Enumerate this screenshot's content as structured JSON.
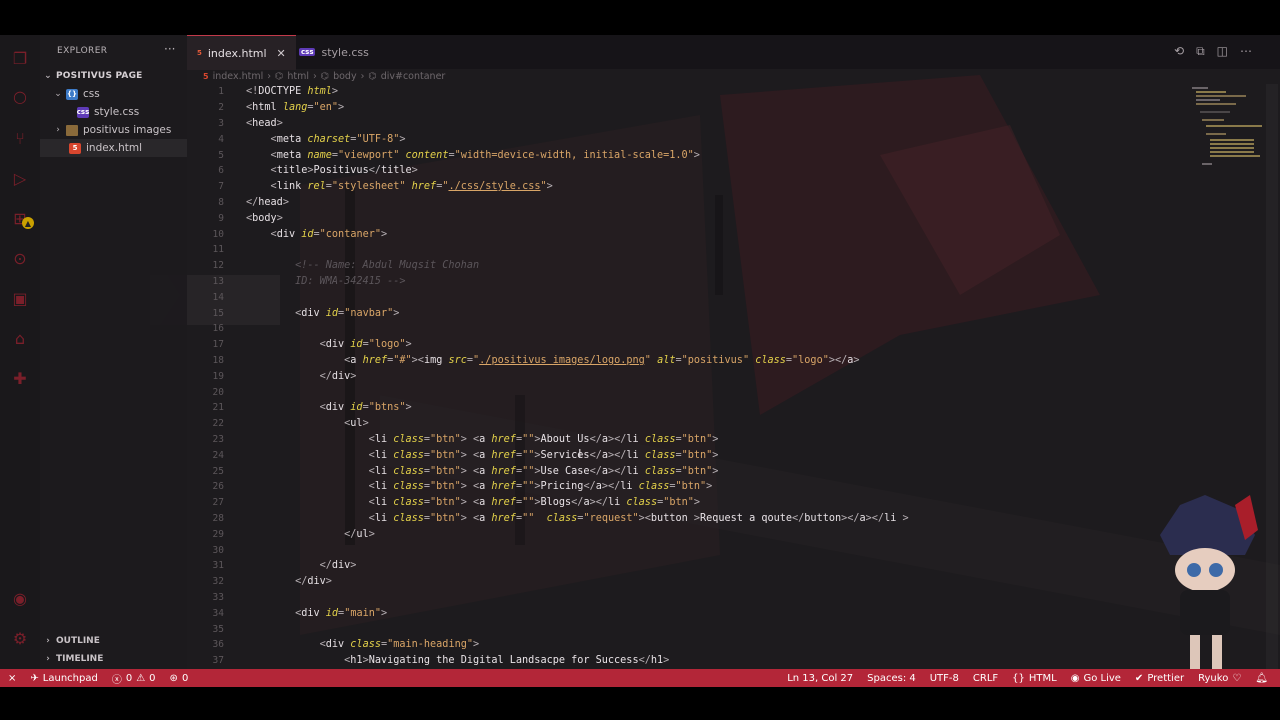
{
  "sidebar": {
    "title": "EXPLORER",
    "more": "···",
    "project": "POSITIVUS PAGE",
    "items": [
      {
        "label": "css",
        "type": "folder-open",
        "indent": 1
      },
      {
        "label": "style.css",
        "type": "css",
        "indent": 2
      },
      {
        "label": "positivus images",
        "type": "folder",
        "indent": 1
      },
      {
        "label": "index.html",
        "type": "html",
        "indent": 1
      }
    ],
    "outline": "OUTLINE",
    "timeline": "TIMELINE"
  },
  "tabs": [
    {
      "label": "index.html",
      "icon": "html-file-icon",
      "active": true
    },
    {
      "label": "style.css",
      "icon": "css-file-icon",
      "active": false
    }
  ],
  "breadcrumb": [
    "index.html",
    "html",
    "body",
    "div#contaner"
  ],
  "code": {
    "line_numbers": [
      "1",
      "2",
      "3",
      "4",
      "5",
      "6",
      "7",
      "8",
      "9",
      "10",
      "11",
      "12",
      "13",
      "14",
      "15",
      "16",
      "17",
      "18",
      "19",
      "20",
      "21",
      "22",
      "23",
      "24",
      "25",
      "26",
      "27",
      "28",
      "29",
      "30",
      "31",
      "32",
      "33",
      "34",
      "35",
      "36",
      "37"
    ],
    "lines": [
      [
        [
          "br",
          "<!"
        ],
        [
          "tag",
          "DOCTYPE "
        ],
        [
          "attr",
          "html"
        ],
        [
          "br",
          ">"
        ]
      ],
      [
        [
          "br",
          "<"
        ],
        [
          "tag",
          "html "
        ],
        [
          "attr",
          "lang"
        ],
        [
          "br",
          "="
        ],
        [
          "str",
          "\"en\""
        ],
        [
          "br",
          ">"
        ]
      ],
      [
        [
          "br",
          "<"
        ],
        [
          "tag",
          "head"
        ],
        [
          "br",
          ">"
        ]
      ],
      [
        [
          "txt",
          "    "
        ],
        [
          "br",
          "<"
        ],
        [
          "tag",
          "meta "
        ],
        [
          "attr",
          "charset"
        ],
        [
          "br",
          "="
        ],
        [
          "str",
          "\"UTF-8\""
        ],
        [
          "br",
          ">"
        ]
      ],
      [
        [
          "txt",
          "    "
        ],
        [
          "br",
          "<"
        ],
        [
          "tag",
          "meta "
        ],
        [
          "attr",
          "name"
        ],
        [
          "br",
          "="
        ],
        [
          "str",
          "\"viewport\" "
        ],
        [
          "attr",
          "content"
        ],
        [
          "br",
          "="
        ],
        [
          "str",
          "\"width=device-width, initial-scale=1.0\""
        ],
        [
          "br",
          ">"
        ]
      ],
      [
        [
          "txt",
          "    "
        ],
        [
          "br",
          "<"
        ],
        [
          "tag",
          "title"
        ],
        [
          "br",
          ">"
        ],
        [
          "txt",
          "Positivus"
        ],
        [
          "br",
          "</"
        ],
        [
          "tag",
          "title"
        ],
        [
          "br",
          ">"
        ]
      ],
      [
        [
          "txt",
          "    "
        ],
        [
          "br",
          "<"
        ],
        [
          "tag",
          "link "
        ],
        [
          "attr",
          "rel"
        ],
        [
          "br",
          "="
        ],
        [
          "str",
          "\"stylesheet\" "
        ],
        [
          "attr",
          "href"
        ],
        [
          "br",
          "="
        ],
        [
          "str",
          "\""
        ],
        [
          "link",
          "./css/style.css"
        ],
        [
          "str",
          "\""
        ],
        [
          "br",
          ">"
        ]
      ],
      [
        [
          "br",
          "</"
        ],
        [
          "tag",
          "head"
        ],
        [
          "br",
          ">"
        ]
      ],
      [
        [
          "br",
          "<"
        ],
        [
          "tag",
          "body"
        ],
        [
          "br",
          ">"
        ]
      ],
      [
        [
          "txt",
          "    "
        ],
        [
          "br",
          "<"
        ],
        [
          "tag",
          "div "
        ],
        [
          "attr",
          "id"
        ],
        [
          "br",
          "="
        ],
        [
          "str",
          "\"contaner\""
        ],
        [
          "br",
          ">"
        ]
      ],
      [],
      [
        [
          "txt",
          "        "
        ],
        [
          "com",
          "<!-- Name: Abdul Muqsit Chohan"
        ]
      ],
      [
        [
          "txt",
          "        "
        ],
        [
          "com",
          "ID: WMA-342415 -->"
        ]
      ],
      [],
      [
        [
          "txt",
          "        "
        ],
        [
          "br",
          "<"
        ],
        [
          "tag",
          "div "
        ],
        [
          "attr",
          "id"
        ],
        [
          "br",
          "="
        ],
        [
          "str",
          "\"navbar\""
        ],
        [
          "br",
          ">"
        ]
      ],
      [],
      [
        [
          "txt",
          "            "
        ],
        [
          "br",
          "<"
        ],
        [
          "tag",
          "div "
        ],
        [
          "attr",
          "id"
        ],
        [
          "br",
          "="
        ],
        [
          "str",
          "\"logo\""
        ],
        [
          "br",
          ">"
        ]
      ],
      [
        [
          "txt",
          "                "
        ],
        [
          "br",
          "<"
        ],
        [
          "tag",
          "a "
        ],
        [
          "attr",
          "href"
        ],
        [
          "br",
          "="
        ],
        [
          "str",
          "\"#\""
        ],
        [
          "br",
          "><"
        ],
        [
          "tag",
          "img "
        ],
        [
          "attr",
          "src"
        ],
        [
          "br",
          "="
        ],
        [
          "str",
          "\""
        ],
        [
          "link",
          "./positivus images/logo.png"
        ],
        [
          "str",
          "\" "
        ],
        [
          "attr",
          "alt"
        ],
        [
          "br",
          "="
        ],
        [
          "str",
          "\"positivus\" "
        ],
        [
          "attr",
          "class"
        ],
        [
          "br",
          "="
        ],
        [
          "str",
          "\"logo\""
        ],
        [
          "br",
          "></"
        ],
        [
          "tag",
          "a"
        ],
        [
          "br",
          ">"
        ]
      ],
      [
        [
          "txt",
          "            "
        ],
        [
          "br",
          "</"
        ],
        [
          "tag",
          "div"
        ],
        [
          "br",
          ">"
        ]
      ],
      [],
      [
        [
          "txt",
          "            "
        ],
        [
          "br",
          "<"
        ],
        [
          "tag",
          "div "
        ],
        [
          "attr",
          "id"
        ],
        [
          "br",
          "="
        ],
        [
          "str",
          "\"btns\""
        ],
        [
          "br",
          ">"
        ]
      ],
      [
        [
          "txt",
          "                "
        ],
        [
          "br",
          "<"
        ],
        [
          "tag",
          "ul"
        ],
        [
          "br",
          ">"
        ]
      ],
      [
        [
          "txt",
          "                    "
        ],
        [
          "br",
          "<"
        ],
        [
          "tag",
          "li "
        ],
        [
          "attr",
          "class"
        ],
        [
          "br",
          "="
        ],
        [
          "str",
          "\"btn\""
        ],
        [
          "br",
          "> <"
        ],
        [
          "tag",
          "a "
        ],
        [
          "attr",
          "href"
        ],
        [
          "br",
          "="
        ],
        [
          "str",
          "\"\""
        ],
        [
          "br",
          ">"
        ],
        [
          "txt",
          "About Us"
        ],
        [
          "br",
          "</"
        ],
        [
          "tag",
          "a"
        ],
        [
          "br",
          "></"
        ],
        [
          "tag",
          "li "
        ],
        [
          "attr",
          "class"
        ],
        [
          "br",
          "="
        ],
        [
          "str",
          "\"btn\""
        ],
        [
          "br",
          ">"
        ]
      ],
      [
        [
          "txt",
          "                    "
        ],
        [
          "br",
          "<"
        ],
        [
          "tag",
          "li "
        ],
        [
          "attr",
          "class"
        ],
        [
          "br",
          "="
        ],
        [
          "str",
          "\"btn\""
        ],
        [
          "br",
          "> <"
        ],
        [
          "tag",
          "a "
        ],
        [
          "attr",
          "href"
        ],
        [
          "br",
          "="
        ],
        [
          "str",
          "\"\""
        ],
        [
          "br",
          ">"
        ],
        [
          "txt",
          "Services"
        ],
        [
          "br",
          "</"
        ],
        [
          "tag",
          "a"
        ],
        [
          "br",
          "></"
        ],
        [
          "tag",
          "li "
        ],
        [
          "attr",
          "class"
        ],
        [
          "br",
          "="
        ],
        [
          "str",
          "\"btn\""
        ],
        [
          "br",
          ">"
        ]
      ],
      [
        [
          "txt",
          "                    "
        ],
        [
          "br",
          "<"
        ],
        [
          "tag",
          "li "
        ],
        [
          "attr",
          "class"
        ],
        [
          "br",
          "="
        ],
        [
          "str",
          "\"btn\""
        ],
        [
          "br",
          "> <"
        ],
        [
          "tag",
          "a "
        ],
        [
          "attr",
          "href"
        ],
        [
          "br",
          "="
        ],
        [
          "str",
          "\"\""
        ],
        [
          "br",
          ">"
        ],
        [
          "txt",
          "Use Case"
        ],
        [
          "br",
          "</"
        ],
        [
          "tag",
          "a"
        ],
        [
          "br",
          "></"
        ],
        [
          "tag",
          "li "
        ],
        [
          "attr",
          "class"
        ],
        [
          "br",
          "="
        ],
        [
          "str",
          "\"btn\""
        ],
        [
          "br",
          ">"
        ]
      ],
      [
        [
          "txt",
          "                    "
        ],
        [
          "br",
          "<"
        ],
        [
          "tag",
          "li "
        ],
        [
          "attr",
          "class"
        ],
        [
          "br",
          "="
        ],
        [
          "str",
          "\"btn\""
        ],
        [
          "br",
          "> <"
        ],
        [
          "tag",
          "a "
        ],
        [
          "attr",
          "href"
        ],
        [
          "br",
          "="
        ],
        [
          "str",
          "\"\""
        ],
        [
          "br",
          ">"
        ],
        [
          "txt",
          "Pricing"
        ],
        [
          "br",
          "</"
        ],
        [
          "tag",
          "a"
        ],
        [
          "br",
          "></"
        ],
        [
          "tag",
          "li "
        ],
        [
          "attr",
          "class"
        ],
        [
          "br",
          "="
        ],
        [
          "str",
          "\"btn\""
        ],
        [
          "br",
          ">"
        ]
      ],
      [
        [
          "txt",
          "                    "
        ],
        [
          "br",
          "<"
        ],
        [
          "tag",
          "li "
        ],
        [
          "attr",
          "class"
        ],
        [
          "br",
          "="
        ],
        [
          "str",
          "\"btn\""
        ],
        [
          "br",
          "> <"
        ],
        [
          "tag",
          "a "
        ],
        [
          "attr",
          "href"
        ],
        [
          "br",
          "="
        ],
        [
          "str",
          "\"\""
        ],
        [
          "br",
          ">"
        ],
        [
          "txt",
          "Blogs"
        ],
        [
          "br",
          "</"
        ],
        [
          "tag",
          "a"
        ],
        [
          "br",
          "></"
        ],
        [
          "tag",
          "li "
        ],
        [
          "attr",
          "class"
        ],
        [
          "br",
          "="
        ],
        [
          "str",
          "\"btn\""
        ],
        [
          "br",
          ">"
        ]
      ],
      [
        [
          "txt",
          "                    "
        ],
        [
          "br",
          "<"
        ],
        [
          "tag",
          "li "
        ],
        [
          "attr",
          "class"
        ],
        [
          "br",
          "="
        ],
        [
          "str",
          "\"btn\""
        ],
        [
          "br",
          "> <"
        ],
        [
          "tag",
          "a "
        ],
        [
          "attr",
          "href"
        ],
        [
          "br",
          "="
        ],
        [
          "str",
          "\"\"  "
        ],
        [
          "attr",
          "class"
        ],
        [
          "br",
          "="
        ],
        [
          "str",
          "\"request\""
        ],
        [
          "br",
          "><"
        ],
        [
          "tag",
          "button "
        ],
        [
          "br",
          ">"
        ],
        [
          "txt",
          "Request a qoute"
        ],
        [
          "br",
          "</"
        ],
        [
          "tag",
          "button"
        ],
        [
          "br",
          "></"
        ],
        [
          "tag",
          "a"
        ],
        [
          "br",
          "></"
        ],
        [
          "tag",
          "li "
        ],
        [
          "br",
          ">"
        ]
      ],
      [
        [
          "txt",
          "                "
        ],
        [
          "br",
          "</"
        ],
        [
          "tag",
          "ul"
        ],
        [
          "br",
          ">"
        ]
      ],
      [],
      [
        [
          "txt",
          "            "
        ],
        [
          "br",
          "</"
        ],
        [
          "tag",
          "div"
        ],
        [
          "br",
          ">"
        ]
      ],
      [
        [
          "txt",
          "        "
        ],
        [
          "br",
          "</"
        ],
        [
          "tag",
          "div"
        ],
        [
          "br",
          ">"
        ]
      ],
      [],
      [
        [
          "txt",
          "        "
        ],
        [
          "br",
          "<"
        ],
        [
          "tag",
          "div "
        ],
        [
          "attr",
          "id"
        ],
        [
          "br",
          "="
        ],
        [
          "str",
          "\"main\""
        ],
        [
          "br",
          ">"
        ]
      ],
      [],
      [
        [
          "txt",
          "            "
        ],
        [
          "br",
          "<"
        ],
        [
          "tag",
          "div "
        ],
        [
          "attr",
          "class"
        ],
        [
          "br",
          "="
        ],
        [
          "str",
          "\"main-heading\""
        ],
        [
          "br",
          ">"
        ]
      ],
      [
        [
          "txt",
          "                "
        ],
        [
          "br",
          "<"
        ],
        [
          "tag",
          "h1"
        ],
        [
          "br",
          ">"
        ],
        [
          "txt",
          "Navigating the Digital Landsacpe for Success"
        ],
        [
          "br",
          "</"
        ],
        [
          "tag",
          "h1"
        ],
        [
          "br",
          ">"
        ]
      ]
    ]
  },
  "status": {
    "launchpad": "Launchpad",
    "errors": "0",
    "warnings": "0",
    "ports": "0",
    "position": "Ln 13, Col 27",
    "spaces": "Spaces: 4",
    "encoding": "UTF-8",
    "eol": "CRLF",
    "language": "HTML",
    "golive": "Go Live",
    "prettier": "Prettier",
    "theme": "Ryuko"
  },
  "colors": {
    "accent": "#b32638",
    "editor_bg": "#1d1b1e",
    "attribute": "#e4d24a",
    "string": "#d9a567"
  }
}
